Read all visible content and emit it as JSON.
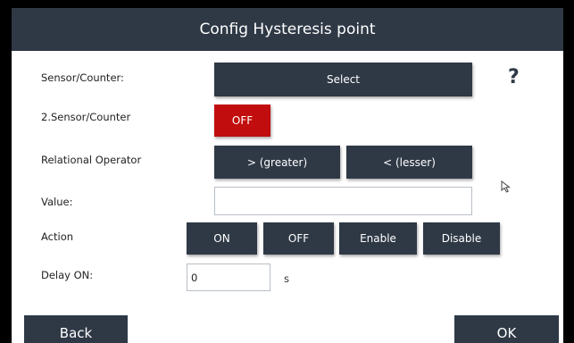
{
  "dialog": {
    "title": "Config Hysteresis point"
  },
  "fields": {
    "sensor_label": "Sensor/Counter:",
    "sensor_button": "Select",
    "help": "?",
    "sensor2_label": "2.Sensor/Counter",
    "sensor2_toggle": "OFF",
    "operator_label": "Relational Operator",
    "operator_greater": "> (greater)",
    "operator_lesser": "< (lesser)",
    "value_label": "Value:",
    "value_input": "",
    "action_label": "Action",
    "action_on": "ON",
    "action_off": "OFF",
    "action_enable": "Enable",
    "action_disable": "Disable",
    "delay_label": "Delay ON:",
    "delay_value": "0",
    "delay_unit": "s"
  },
  "footer": {
    "back": "Back",
    "ok": "OK"
  },
  "colors": {
    "titlebar": "#2f3946",
    "button": "#2f3946",
    "toggle_off": "#c10d0d"
  },
  "icons": {
    "cursor": "mouse-pointer-icon"
  }
}
